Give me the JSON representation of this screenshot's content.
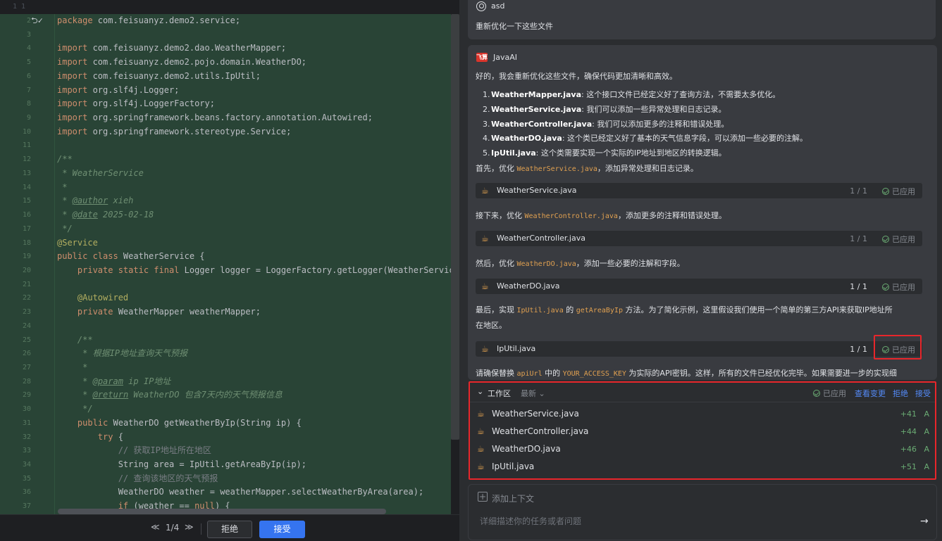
{
  "editor": {
    "first_line": "1 1",
    "marker": "2",
    "marker_symbol": "⮌",
    "check_symbol": "✓",
    "lines": [
      {
        "n": "2",
        "html": "<span class=\"kw\">package</span> com.feisuanyz.demo2.service;"
      },
      {
        "n": "3",
        "html": ""
      },
      {
        "n": "4",
        "html": "<span class=\"kw\">import</span> com.feisuanyz.demo2.dao.WeatherMapper;"
      },
      {
        "n": "5",
        "html": "<span class=\"kw\">import</span> com.feisuanyz.demo2.pojo.domain.WeatherDO;"
      },
      {
        "n": "6",
        "html": "<span class=\"kw\">import</span> com.feisuanyz.demo2.utils.IpUtil;"
      },
      {
        "n": "7",
        "html": "<span class=\"kw\">import</span> org.slf4j.Logger;"
      },
      {
        "n": "8",
        "html": "<span class=\"kw\">import</span> org.slf4j.LoggerFactory;"
      },
      {
        "n": "9",
        "html": "<span class=\"kw\">import</span> org.springframework.beans.factory.annotation.Autowired;"
      },
      {
        "n": "10",
        "html": "<span class=\"kw\">import</span> org.springframework.stereotype.Service;"
      },
      {
        "n": "11",
        "html": ""
      },
      {
        "n": "12",
        "html": "<span class=\"doc\">/**</span>"
      },
      {
        "n": "13",
        "html": "<span class=\"doc\"> * WeatherService</span>"
      },
      {
        "n": "14",
        "html": "<span class=\"doc\"> *</span>"
      },
      {
        "n": "15",
        "html": "<span class=\"doc\"> * </span><span class=\"doctag\">@author</span><span class=\"doc\"> xieh</span>"
      },
      {
        "n": "16",
        "html": "<span class=\"doc\"> * </span><span class=\"doctag\">@date</span><span class=\"doc\"> 2025-02-18</span>"
      },
      {
        "n": "17",
        "html": "<span class=\"doc\"> */</span>"
      },
      {
        "n": "18",
        "html": "<span class=\"an\">@Service</span>"
      },
      {
        "n": "19",
        "html": "<span class=\"kw\">public class</span> WeatherService {"
      },
      {
        "n": "20",
        "html": "    <span class=\"kw\">private static final</span> Logger logger = LoggerFactory.getLogger(WeatherServic"
      },
      {
        "n": "21",
        "html": ""
      },
      {
        "n": "22",
        "html": "    <span class=\"an\">@Autowired</span>"
      },
      {
        "n": "23",
        "html": "    <span class=\"kw\">private</span> WeatherMapper weatherMapper;"
      },
      {
        "n": "24",
        "html": ""
      },
      {
        "n": "25",
        "html": "    <span class=\"doc\">/**</span>"
      },
      {
        "n": "26",
        "html": "    <span class=\"doc\"> * 根据IP地址查询天气预报</span>"
      },
      {
        "n": "27",
        "html": "    <span class=\"doc\"> *</span>"
      },
      {
        "n": "28",
        "html": "    <span class=\"doc\"> * </span><span class=\"doctag\">@param</span><span class=\"doc\"> ip IP地址</span>"
      },
      {
        "n": "29",
        "html": "    <span class=\"doc\"> * </span><span class=\"doctag\">@return</span><span class=\"doc\"> WeatherDO 包含7天内的天气预报信息</span>"
      },
      {
        "n": "30",
        "html": "    <span class=\"doc\"> */</span>"
      },
      {
        "n": "31",
        "html": "    <span class=\"kw\">public</span> WeatherDO getWeatherByIp(String ip) {"
      },
      {
        "n": "32",
        "html": "        <span class=\"kw\">try</span> {"
      },
      {
        "n": "33",
        "html": "            <span class=\"cmt\">// 获取IP地址所在地区</span>"
      },
      {
        "n": "34",
        "html": "            String area = IpUtil.getAreaByIp(ip);"
      },
      {
        "n": "35",
        "html": "            <span class=\"cmt\">// 查询该地区的天气预报</span>"
      },
      {
        "n": "36",
        "html": "            WeatherDO weather = weatherMapper.selectWeatherByArea(area);"
      },
      {
        "n": "37",
        "html": "            <span class=\"kw\">if</span> (weather == <span class=\"kw\">null</span>) {"
      }
    ],
    "footer": {
      "prev": "≪",
      "page": "1/4",
      "next": "≫",
      "reject_label": "拒绝",
      "accept_label": "接受"
    }
  },
  "chat": {
    "user": {
      "name": "asd",
      "message": "重新优化一下这些文件"
    },
    "ai": {
      "logo_text": "飞算",
      "name": "JavaAI",
      "intro": "好的，我会重新优化这些文件，确保代码更加清晰和高效。",
      "items": [
        {
          "num": "1.",
          "file": "WeatherMapper.java",
          "desc": ": 这个接口文件已经定义好了查询方法，不需要太多优化。"
        },
        {
          "num": "2.",
          "file": "WeatherService.java",
          "desc": ": 我们可以添加一些异常处理和日志记录。"
        },
        {
          "num": "3.",
          "file": "WeatherController.java",
          "desc": ": 我们可以添加更多的注释和错误处理。"
        },
        {
          "num": "4.",
          "file": "WeatherDO.java",
          "desc": ": 这个类已经定义好了基本的天气信息字段，可以添加一些必要的注解。"
        },
        {
          "num": "5.",
          "file": "IpUtil.java",
          "desc": ": 这个类需要实现一个实际的IP地址到地区的转换逻辑。"
        }
      ],
      "step1_pre": "首先，优化 ",
      "step1_code": "WeatherService.java",
      "step1_post": "，添加异常处理和日志记录。",
      "step2_pre": "接下来，优化 ",
      "step2_code": "WeatherController.java",
      "step2_post": "，添加更多的注释和错误处理。",
      "step3_pre": "然后，优化 ",
      "step3_code": "WeatherDO.java",
      "step3_post": "，添加一些必要的注解和字段。",
      "step4_pre": "最后，实现 ",
      "step4_code": "IpUtil.java",
      "step4_mid": " 的 ",
      "step4_code2": "getAreaByIp",
      "step4_post": " 方法。为了简化示例，这里假设我们使用一个简单的第三方API来获取IP地址所",
      "step4_line2": "在地区。",
      "final_pre": "请确保替换 ",
      "final_code": "apiUrl",
      "final_mid": " 中的 ",
      "final_code2": "YOUR_ACCESS_KEY",
      "final_post": " 为实际的API密钥。这样，所有的文件已经优化完毕。如果需要进一步的实现细",
      "file_blocks": [
        {
          "name": "WeatherService.java",
          "count": "1 / 1",
          "applied": "已应用"
        },
        {
          "name": "WeatherController.java",
          "count": "1 / 1",
          "applied": "已应用"
        },
        {
          "name": "WeatherDO.java",
          "count": "1 / 1",
          "applied": "已应用"
        },
        {
          "name": "IpUtil.java",
          "count": "1 / 1",
          "applied": "已应用"
        }
      ]
    },
    "workspace": {
      "title": "工作区",
      "sort": "最新",
      "applied": "已应用",
      "view_changes": "查看变更",
      "reject": "拒绝",
      "accept": "接受",
      "files": [
        {
          "name": "WeatherService.java",
          "added": "+41",
          "status": "A"
        },
        {
          "name": "WeatherController.java",
          "added": "+44",
          "status": "A"
        },
        {
          "name": "WeatherDO.java",
          "added": "+46",
          "status": "A"
        },
        {
          "name": "IpUtil.java",
          "added": "+51",
          "status": "A"
        }
      ]
    },
    "input": {
      "add_context": "添加上下文",
      "placeholder": "详细描述你的任务或者问题",
      "send_icon": "→"
    }
  },
  "colors": {
    "diff_background": "#294436",
    "accent_blue": "#3574f0",
    "highlight_red": "#e8262b",
    "added_green": "#6aab73"
  }
}
